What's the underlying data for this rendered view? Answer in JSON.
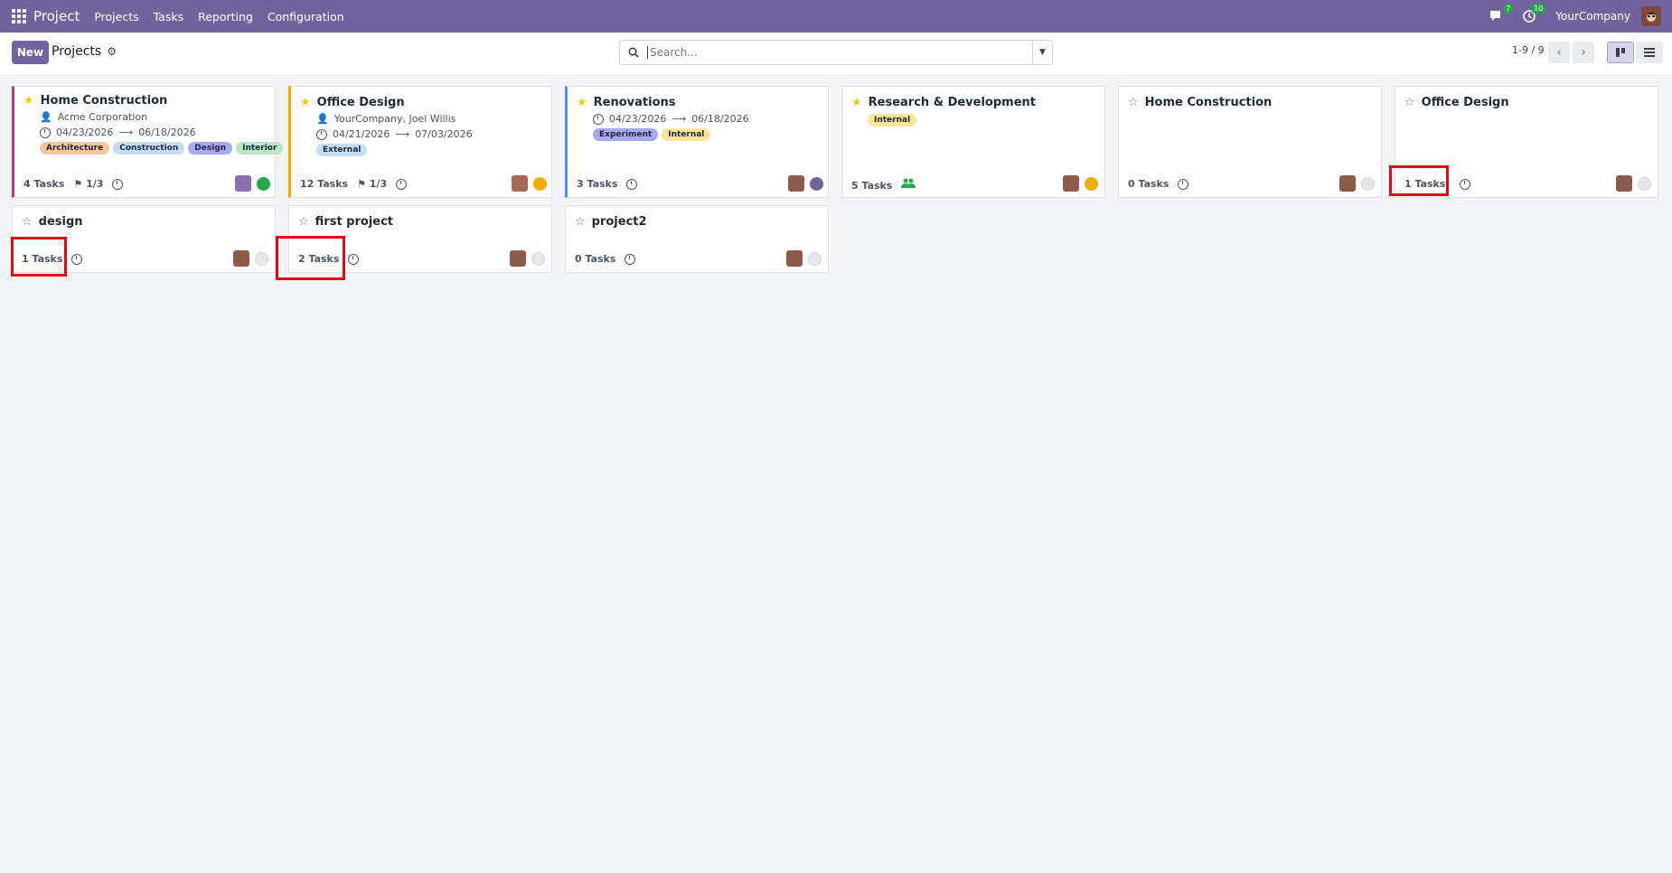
{
  "navbar": {
    "brand": "Project",
    "menu": [
      "Projects",
      "Tasks",
      "Reporting",
      "Configuration"
    ],
    "chat_badge": "7",
    "activity_badge": "10",
    "company": "YourCompany"
  },
  "control": {
    "new_label": "New",
    "breadcrumb": "Projects",
    "search_placeholder": "Search...",
    "pager": "1-9 / 9"
  },
  "cards": [
    {
      "title": "Home Construction",
      "starred": true,
      "customer": "Acme Corporation",
      "date_start": "04/23/2026",
      "date_end": "06/18/2026",
      "tags": [
        "Architecture",
        "Construction",
        "Design",
        "Interior"
      ],
      "tasks": "4 Tasks",
      "milestones": "1/3",
      "status_color": "#28a745"
    },
    {
      "title": "Office Design",
      "starred": true,
      "customer": "YourCompany, Joel Willis",
      "date_start": "04/21/2026",
      "date_end": "07/03/2026",
      "tags": [
        "External"
      ],
      "tasks": "12 Tasks",
      "milestones": "1/3",
      "status_color": "#f0ad00"
    },
    {
      "title": "Renovations",
      "starred": true,
      "date_start": "04/23/2026",
      "date_end": "06/18/2026",
      "tags": [
        "Experiment",
        "Internal"
      ],
      "tasks": "3 Tasks",
      "status_color": "#71639e"
    },
    {
      "title": "Research & Development",
      "starred": true,
      "tags": [
        "Internal"
      ],
      "tasks": "5 Tasks",
      "status_color": "#f0ad00"
    },
    {
      "title": "Home Construction",
      "starred": false,
      "tasks": "0 Tasks"
    },
    {
      "title": "Office Design",
      "starred": false,
      "tasks": "1 Tasks"
    },
    {
      "title": "design",
      "starred": false,
      "tasks": "1 Tasks"
    },
    {
      "title": "first project",
      "starred": false,
      "tasks": "2 Tasks"
    },
    {
      "title": "project2",
      "starred": false,
      "tasks": "0 Tasks"
    }
  ],
  "colors": {
    "brand": "#71639e",
    "highlight": "#e30613",
    "tag_architecture": "#f7c59f",
    "tag_construction": "#c7dcf7",
    "tag_design": "#a9a8f0",
    "tag_interior": "#b9e4c9",
    "tag_external": "#c7dcf7",
    "tag_experiment": "#a9a8f0",
    "tag_internal": "#fbe59a"
  }
}
